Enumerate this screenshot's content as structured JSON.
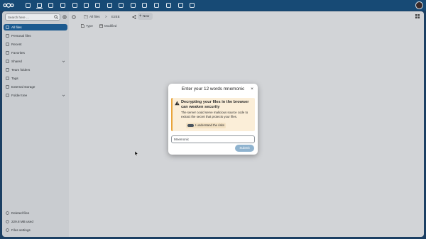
{
  "topbar": {
    "apps": [
      "dashboard-icon",
      "files-icon",
      "activity-icon",
      "photos-icon",
      "mail-icon",
      "contacts-icon",
      "calendar-icon",
      "notes-icon",
      "deck-icon",
      "tasks-icon",
      "maps-icon",
      "settings-icon",
      "forms-icon",
      "talk-icon",
      "edit-icon"
    ]
  },
  "sidebar": {
    "search_placeholder": "Search here …",
    "items": [
      {
        "label": "All files",
        "icon": "folder-icon",
        "active": true
      },
      {
        "label": "Personal files",
        "icon": "user-icon"
      },
      {
        "label": "Recent",
        "icon": "clock-icon"
      },
      {
        "label": "Favorites",
        "icon": "star-icon"
      },
      {
        "label": "Shared",
        "icon": "share-icon",
        "expandable": true
      },
      {
        "label": "Team folders",
        "icon": "group-icon"
      },
      {
        "label": "Tags",
        "icon": "tag-icon"
      },
      {
        "label": "External storage",
        "icon": "storage-icon"
      },
      {
        "label": "Folder tree",
        "icon": "tree-icon",
        "expandable": true
      }
    ],
    "footer": [
      {
        "label": "Deleted files",
        "icon": "trash-icon"
      },
      {
        "label": "229.8 MB used",
        "icon": "quota-icon"
      },
      {
        "label": "Files settings",
        "icon": "gear-icon"
      }
    ]
  },
  "main": {
    "breadcrumb": {
      "root": "All files",
      "separator": ">",
      "current": "E2EE"
    },
    "new_label": "New",
    "columns": {
      "type": "Type",
      "modified": "Modified"
    }
  },
  "modal": {
    "title": "Enter your 12 words mnemonic",
    "close": "×",
    "warning_title": "Decrypting your files in the browser can weaken security",
    "warning_body": "The server could serve malicious source code to extract the secret that protects your files.",
    "understand_label": "I understand the risks",
    "input_placeholder": "Mnemonic",
    "submit_label": "Submit"
  },
  "colors": {
    "topbar": "#174a75",
    "active_nav": "#1c5a8f",
    "warning_border": "#e9a43a",
    "submit": "#8fb3cf"
  }
}
